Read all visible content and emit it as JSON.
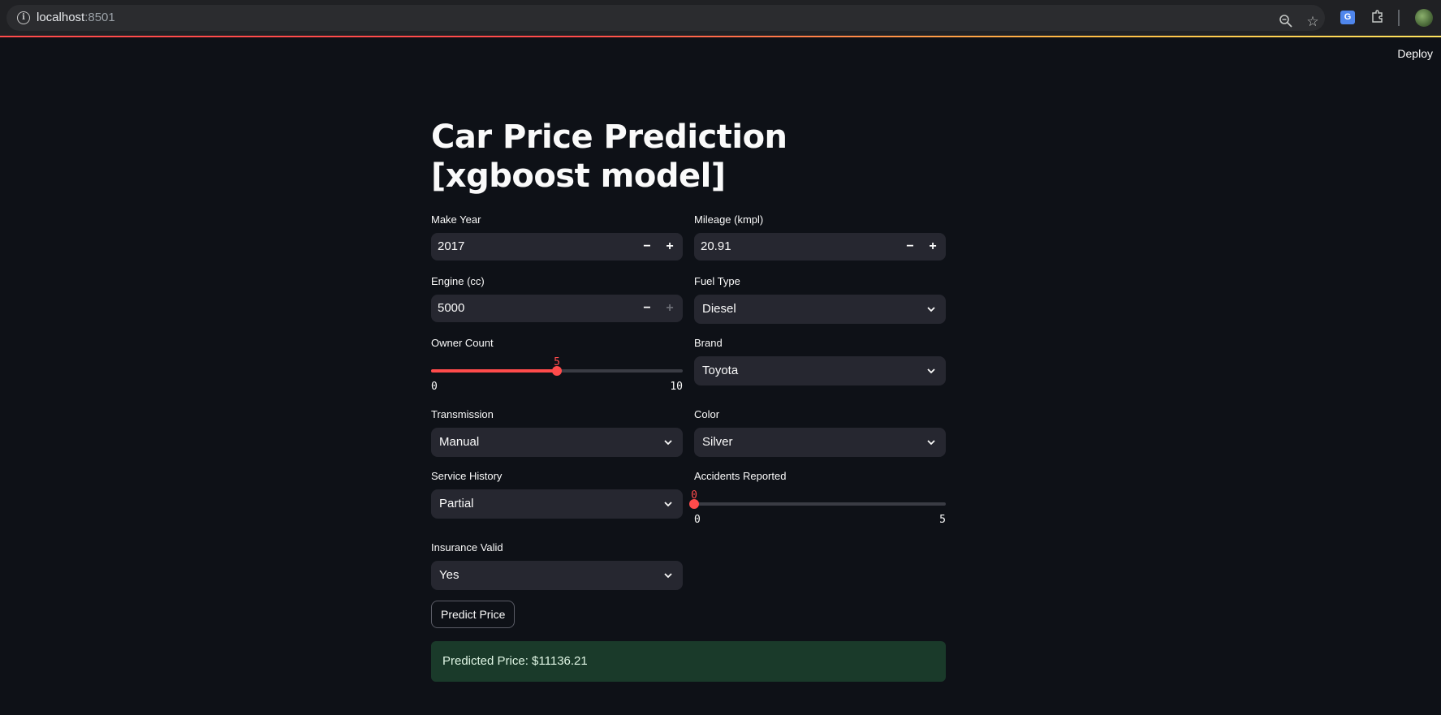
{
  "browser": {
    "host": "localhost",
    "port": ":8501"
  },
  "header": {
    "deploy_label": "Deploy"
  },
  "page": {
    "title": "Car Price Prediction [xgboost model]"
  },
  "form": {
    "make_year": {
      "label": "Make Year",
      "value": "2017"
    },
    "mileage": {
      "label": "Mileage (kmpl)",
      "value": "20.91"
    },
    "engine": {
      "label": "Engine (cc)",
      "value": "5000"
    },
    "fuel_type": {
      "label": "Fuel Type",
      "value": "Diesel"
    },
    "owner_count": {
      "label": "Owner Count",
      "value": "5",
      "min": "0",
      "max": "10",
      "fraction": 0.5
    },
    "brand": {
      "label": "Brand",
      "value": "Toyota"
    },
    "transmission": {
      "label": "Transmission",
      "value": "Manual"
    },
    "color": {
      "label": "Color",
      "value": "Silver"
    },
    "service_history": {
      "label": "Service History",
      "value": "Partial"
    },
    "accidents_reported": {
      "label": "Accidents Reported",
      "value": "0",
      "min": "0",
      "max": "5",
      "fraction": 0
    },
    "insurance_valid": {
      "label": "Insurance Valid",
      "value": "Yes"
    },
    "step_minus": "−",
    "step_plus": "+"
  },
  "actions": {
    "predict_label": "Predict Price"
  },
  "result": {
    "text": "Predicted Price: $11136.21"
  },
  "colors": {
    "background": "#0e1117",
    "accent": "#ff4b4b",
    "input_bg": "#262730",
    "success_bg": "#1a3a2a"
  }
}
